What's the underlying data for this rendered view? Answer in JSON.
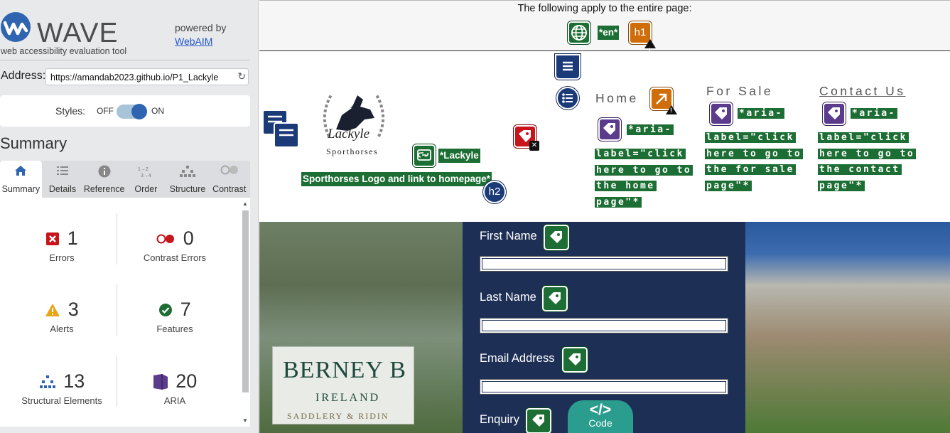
{
  "sidebar": {
    "brand": {
      "name": "WAVE",
      "tagline": "web accessibility evaluation tool",
      "powered_by": "powered by",
      "webaim": "WebAIM"
    },
    "address": {
      "label": "Address:",
      "value": "https://amandab2023.github.io/P1_Lackyle"
    },
    "styles": {
      "label": "Styles:",
      "off": "OFF",
      "on": "ON"
    },
    "summary_title": "Summary",
    "tabs": [
      {
        "label": "Summary",
        "icon": "home-icon",
        "active": true
      },
      {
        "label": "Details",
        "icon": "list-icon"
      },
      {
        "label": "Reference",
        "icon": "info-icon"
      },
      {
        "label": "Order",
        "icon": "order-icon"
      },
      {
        "label": "Structure",
        "icon": "structure-icon"
      },
      {
        "label": "Contrast",
        "icon": "contrast-icon"
      }
    ],
    "stats": [
      {
        "count": "1",
        "label": "Errors",
        "icon": "error-icon",
        "color": "#c8141b"
      },
      {
        "count": "0",
        "label": "Contrast Errors",
        "icon": "contrast-error-icon",
        "color": "#c8141b"
      },
      {
        "count": "3",
        "label": "Alerts",
        "icon": "alert-icon",
        "color": "#e8a317"
      },
      {
        "count": "7",
        "label": "Features",
        "icon": "feature-icon",
        "color": "#1d6e34"
      },
      {
        "count": "13",
        "label": "Structural Elements",
        "icon": "structure-icon",
        "color": "#2e64b0"
      },
      {
        "count": "20",
        "label": "ARIA",
        "icon": "aria-icon",
        "color": "#5b3b8c"
      }
    ]
  },
  "page": {
    "info_text": "The following apply to the entire page:",
    "lang_badge": "*en*",
    "h1_badge": "h1",
    "h2_badge": "h2",
    "logo": {
      "name": "Lackyle",
      "sub": "Sporthorses"
    },
    "logo_alt_line1": "*Lackyle",
    "logo_alt_line2": "Sporthorses Logo and link to homepage*",
    "nav": [
      {
        "label": "Home",
        "aria": [
          "*aria-",
          "label=\"click",
          "here to go to",
          "the home",
          "page\"*"
        ]
      },
      {
        "label": "For Sale",
        "aria": [
          "*aria-",
          "label=\"click",
          "here to go to",
          "the for sale",
          "page\"*"
        ]
      },
      {
        "label": "Contact Us",
        "aria": [
          "*aria-",
          "label=\"click",
          "here to go to",
          "the contact",
          "page\"*"
        ]
      }
    ],
    "form": {
      "fields": [
        "First Name",
        "Last Name",
        "Email Address",
        "Enquiry"
      ]
    },
    "banner": {
      "line1": "BERNEY B",
      "line2": "IRELAND",
      "line3": "SADDLERY & RIDIN"
    },
    "code_label": "Code",
    "code_glyph": "</>",
    "colors": {
      "feature": "#1d6e34",
      "alert": "#d06d0b",
      "error": "#c8141b",
      "aria": "#5b3b8c",
      "structure": "#1b3a78",
      "form_panel": "#1e2f55"
    }
  }
}
